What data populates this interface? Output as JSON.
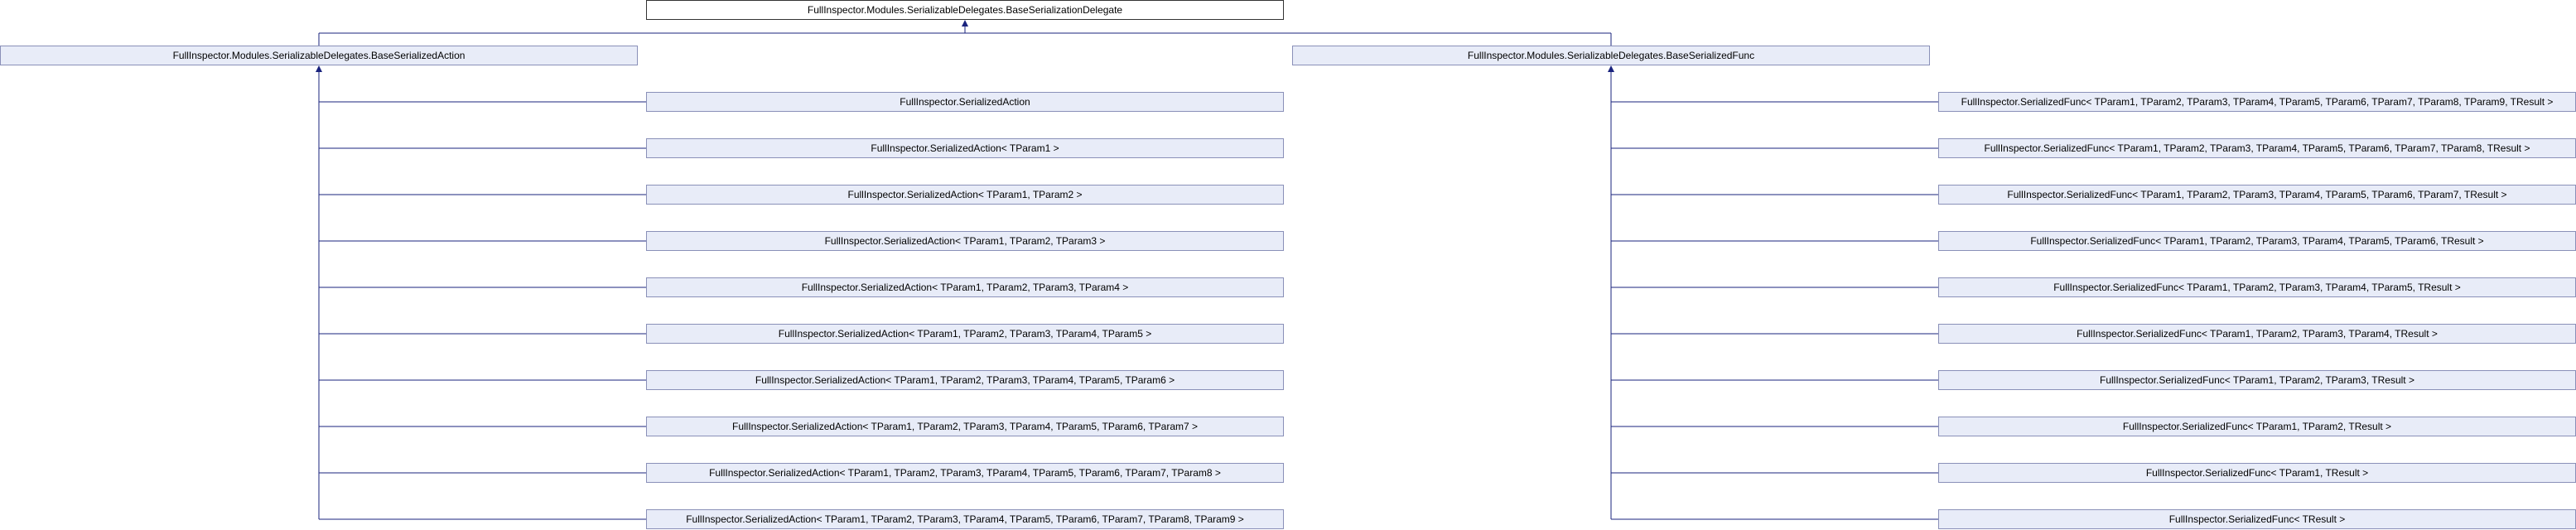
{
  "root": "FullInspector.Modules.SerializableDelegates.BaseSerializationDelegate",
  "bases": [
    "FullInspector.Modules.SerializableDelegates.BaseSerializedAction",
    "FullInspector.Modules.SerializableDelegates.BaseSerializedFunc"
  ],
  "actions": [
    "FullInspector.SerializedAction",
    "FullInspector.SerializedAction< TParam1 >",
    "FullInspector.SerializedAction< TParam1, TParam2 >",
    "FullInspector.SerializedAction< TParam1, TParam2, TParam3 >",
    "FullInspector.SerializedAction< TParam1, TParam2, TParam3, TParam4 >",
    "FullInspector.SerializedAction< TParam1, TParam2, TParam3, TParam4, TParam5 >",
    "FullInspector.SerializedAction< TParam1, TParam2, TParam3, TParam4, TParam5, TParam6 >",
    "FullInspector.SerializedAction< TParam1, TParam2, TParam3, TParam4, TParam5, TParam6, TParam7 >",
    "FullInspector.SerializedAction< TParam1, TParam2, TParam3, TParam4, TParam5, TParam6, TParam7, TParam8 >",
    "FullInspector.SerializedAction< TParam1, TParam2, TParam3, TParam4, TParam5, TParam6, TParam7, TParam8, TParam9 >"
  ],
  "funcs": [
    "FullInspector.SerializedFunc< TParam1, TParam2, TParam3, TParam4, TParam5, TParam6, TParam7, TParam8, TParam9, TResult >",
    "FullInspector.SerializedFunc< TParam1, TParam2, TParam3, TParam4, TParam5, TParam6, TParam7, TParam8, TResult >",
    "FullInspector.SerializedFunc< TParam1, TParam2, TParam3, TParam4, TParam5, TParam6, TParam7, TResult >",
    "FullInspector.SerializedFunc< TParam1, TParam2, TParam3, TParam4, TParam5, TParam6, TResult >",
    "FullInspector.SerializedFunc< TParam1, TParam2, TParam3, TParam4, TParam5, TResult >",
    "FullInspector.SerializedFunc< TParam1, TParam2, TParam3, TParam4, TResult >",
    "FullInspector.SerializedFunc< TParam1, TParam2, TParam3, TResult >",
    "FullInspector.SerializedFunc< TParam1, TParam2, TResult >",
    "FullInspector.SerializedFunc< TParam1, TResult >",
    "FullInspector.SerializedFunc< TResult >"
  ],
  "colors": {
    "node_fill": "#e8ecf8",
    "node_border": "#8a90b8",
    "edge": "#1a237e"
  }
}
